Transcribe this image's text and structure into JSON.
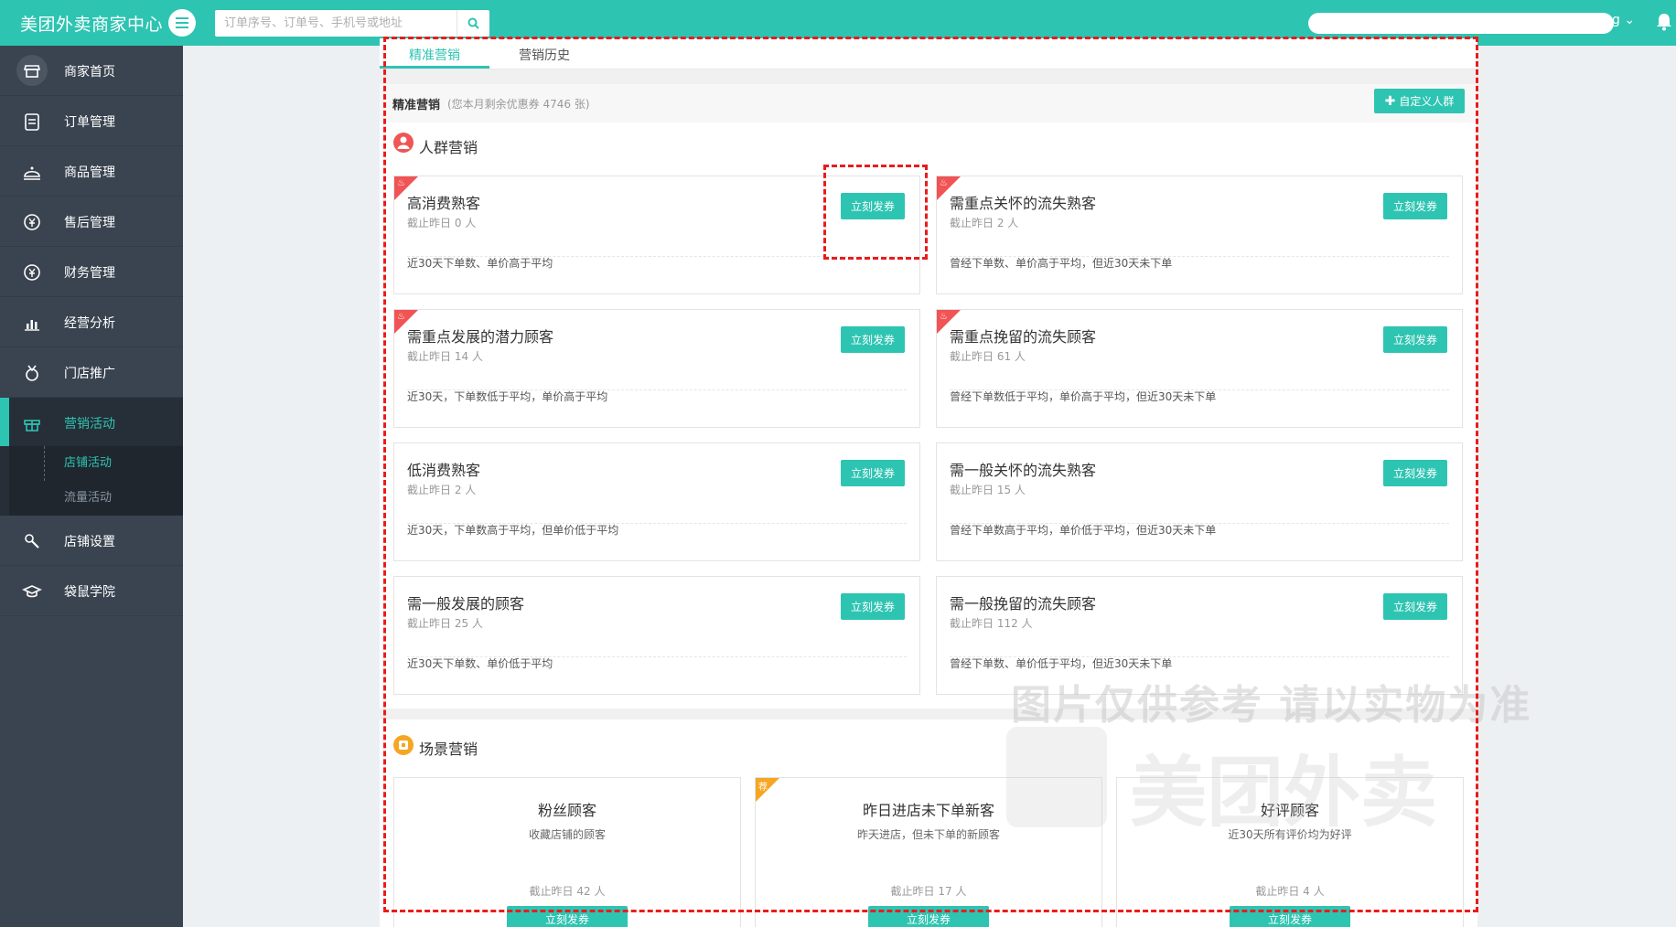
{
  "app": {
    "title": "美团外卖商家中心"
  },
  "search": {
    "placeholder": "订单序号、订单号、手机号或地址"
  },
  "header": {
    "user_suffix": "g ⌄"
  },
  "sidebar": {
    "items": [
      {
        "id": "home",
        "label": "商家首页",
        "icon": "store-icon"
      },
      {
        "id": "orders",
        "label": "订单管理",
        "icon": "clipboard-icon"
      },
      {
        "id": "products",
        "label": "商品管理",
        "icon": "dish-icon"
      },
      {
        "id": "aftersale",
        "label": "售后管理",
        "icon": "yen-refund-icon"
      },
      {
        "id": "finance",
        "label": "财务管理",
        "icon": "yen-circle-icon"
      },
      {
        "id": "analytics",
        "label": "经营分析",
        "icon": "bar-chart-icon"
      },
      {
        "id": "promotion",
        "label": "门店推广",
        "icon": "medal-icon"
      },
      {
        "id": "marketing",
        "label": "营销活动",
        "icon": "gift-icon"
      },
      {
        "id": "settings",
        "label": "店铺设置",
        "icon": "wrench-icon"
      },
      {
        "id": "academy",
        "label": "袋鼠学院",
        "icon": "graduation-cap-icon"
      }
    ],
    "sub_items": [
      {
        "label": "店铺活动",
        "active": true
      },
      {
        "label": "流量活动",
        "active": false
      }
    ]
  },
  "tabs": [
    {
      "label": "精准营销",
      "active": true
    },
    {
      "label": "营销历史",
      "active": false
    }
  ],
  "section": {
    "title": "精准营销",
    "subtitle": "(您本月剩余优惠券 4746 张)",
    "custom_button": "自定义人群"
  },
  "crowd": {
    "title": "人群营销",
    "cards": [
      {
        "title": "高消费熟客",
        "count": "截止昨日 0 人",
        "desc": "近30天下单数、单价高于平均",
        "button": "立刻发券",
        "hot": true
      },
      {
        "title": "需重点关怀的流失熟客",
        "count": "截止昨日 2 人",
        "desc": "曾经下单数、单价高于平均，但近30天未下单",
        "button": "立刻发券",
        "hot": true
      },
      {
        "title": "需重点发展的潜力顾客",
        "count": "截止昨日 14 人",
        "desc": "近30天，下单数低于平均，单价高于平均",
        "button": "立刻发券",
        "hot": true
      },
      {
        "title": "需重点挽留的流失顾客",
        "count": "截止昨日 61 人",
        "desc": "曾经下单数低于平均，单价高于平均，但近30天未下单",
        "button": "立刻发券",
        "hot": true
      },
      {
        "title": "低消费熟客",
        "count": "截止昨日 2 人",
        "desc": "近30天，下单数高于平均，但单价低于平均",
        "button": "立刻发券",
        "hot": false
      },
      {
        "title": "需一般关怀的流失熟客",
        "count": "截止昨日 15 人",
        "desc": "曾经下单数高于平均，单价低于平均，但近30天未下单",
        "button": "立刻发券",
        "hot": false
      },
      {
        "title": "需一般发展的顾客",
        "count": "截止昨日 25 人",
        "desc": "近30天下单数、单价低于平均",
        "button": "立刻发券",
        "hot": false
      },
      {
        "title": "需一般挽留的流失顾客",
        "count": "截止昨日 112 人",
        "desc": "曾经下单数、单价低于平均，但近30天未下单",
        "button": "立刻发券",
        "hot": false
      }
    ]
  },
  "scene": {
    "title": "场景营销",
    "cards": [
      {
        "title": "粉丝顾客",
        "desc": "收藏店铺的顾客",
        "count": "截止昨日 42 人",
        "button": "立刻发券",
        "badge": ""
      },
      {
        "title": "昨日进店未下单新客",
        "desc": "昨天进店，但未下单的新顾客",
        "count": "截止昨日 17 人",
        "button": "立刻发券",
        "badge": "荐"
      },
      {
        "title": "好评顾客",
        "desc": "近30天所有评价均为好评",
        "count": "截止昨日 4 人",
        "button": "立刻发券",
        "badge": ""
      }
    ]
  },
  "watermark": {
    "line1": "图片仅供参考 请以实物为准",
    "line2": "美团外卖"
  },
  "colors": {
    "brand": "#2ec4b2",
    "sidebar": "#3a4450",
    "hot": "#f05454",
    "badge": "#f5a623",
    "highlight": "#e81c1c"
  }
}
